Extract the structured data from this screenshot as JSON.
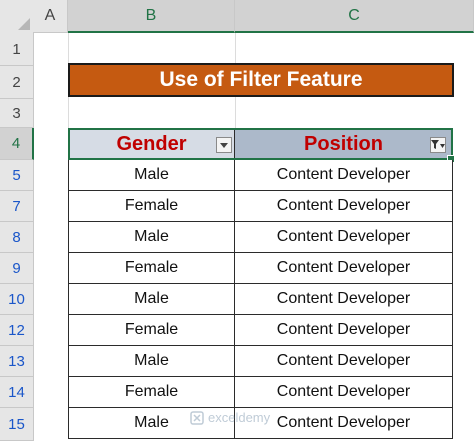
{
  "columns": [
    "A",
    "B",
    "C"
  ],
  "rows": [
    "1",
    "2",
    "3",
    "4",
    "5",
    "7",
    "8",
    "9",
    "10",
    "12",
    "13",
    "14",
    "15"
  ],
  "title": "Use of Filter Feature",
  "table": {
    "headers": {
      "gender": "Gender",
      "position": "Position"
    },
    "rows": [
      {
        "gender": "Male",
        "position": "Content Developer"
      },
      {
        "gender": "Female",
        "position": "Content Developer"
      },
      {
        "gender": "Male",
        "position": "Content Developer"
      },
      {
        "gender": "Female",
        "position": "Content Developer"
      },
      {
        "gender": "Male",
        "position": "Content Developer"
      },
      {
        "gender": "Female",
        "position": "Content Developer"
      },
      {
        "gender": "Male",
        "position": "Content Developer"
      },
      {
        "gender": "Female",
        "position": "Content Developer"
      },
      {
        "gender": "Male",
        "position": "Content Developer"
      }
    ]
  },
  "watermark": "exceldemy",
  "icons": {
    "gender_filter": "dropdown-arrow-icon",
    "position_filter": "filter-applied-icon"
  },
  "colors": {
    "title_bg": "#c55a11",
    "header_text": "#c00000",
    "filtered_row_numbers": "#1a56c9",
    "selection": "#217346"
  }
}
